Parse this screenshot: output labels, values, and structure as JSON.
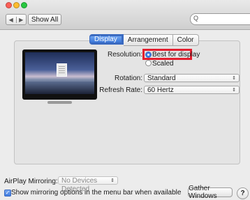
{
  "toolbar": {
    "back_glyph": "◀",
    "forward_glyph": "▶",
    "show_all_label": "Show All",
    "search_placeholder": "",
    "search_glyph": "Q"
  },
  "tabs": [
    {
      "label": "Display",
      "selected": true,
      "highlighted": true
    },
    {
      "label": "Arrangement",
      "selected": false
    },
    {
      "label": "Color",
      "selected": false
    }
  ],
  "display": {
    "resolution_label": "Resolution:",
    "resolution_options": [
      {
        "label": "Best for display",
        "selected": true
      },
      {
        "label": "Scaled",
        "selected": false
      }
    ],
    "rotation_label": "Rotation:",
    "rotation_value": "Standard",
    "refresh_label": "Refresh Rate:",
    "refresh_value": "60 Hertz",
    "select_arrows": "⇕"
  },
  "footer": {
    "airplay_label": "AirPlay Mirroring:",
    "airplay_value": "No Devices Detected",
    "mirroring_checkbox_label": "Show mirroring options in the menu bar when available",
    "mirroring_checked": true,
    "gather_windows_label": "Gather Windows",
    "help_glyph": "?"
  },
  "colors": {
    "highlight": "#e41e2e",
    "accent_blue": "#3f7be0"
  }
}
